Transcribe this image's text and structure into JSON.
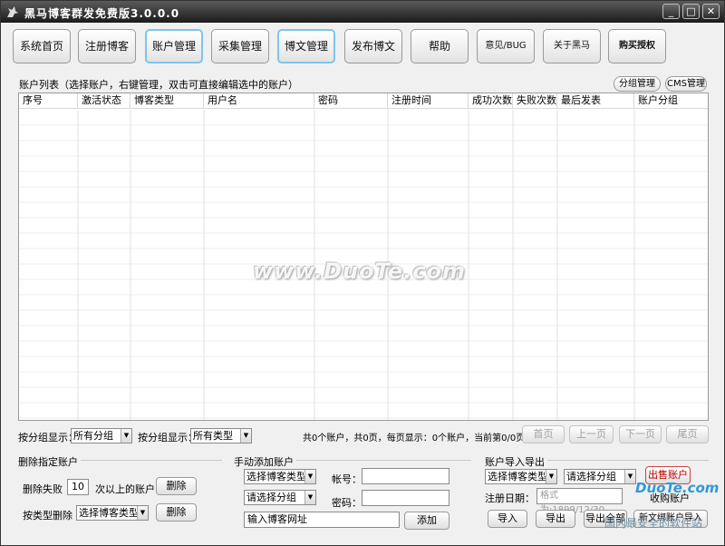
{
  "window": {
    "title": "黑马博客群发免费版3.0.0.0",
    "min": "_",
    "max": "□",
    "close": "✕"
  },
  "nav": [
    {
      "label": "系统首页",
      "highlight": false
    },
    {
      "label": "注册博客",
      "highlight": false
    },
    {
      "label": "账户管理",
      "highlight": true
    },
    {
      "label": "采集管理",
      "highlight": false
    },
    {
      "label": "博文管理",
      "highlight": true
    },
    {
      "label": "发布博文",
      "highlight": false
    },
    {
      "label": "帮助",
      "highlight": false
    },
    {
      "label": "意见/BUG",
      "highlight": false
    },
    {
      "label": "关于黑马",
      "highlight": false
    },
    {
      "label": "购买授权",
      "highlight": false
    }
  ],
  "list": {
    "caption": "账户列表（选择账户，右键管理，双击可直接编辑选中的账户）",
    "group_manage": "分组管理",
    "cms_manage": "CMS管理",
    "columns": [
      "序号",
      "激活状态",
      "博客类型",
      "用户名",
      "密码",
      "注册时间",
      "成功次数",
      "失败次数",
      "最后发表",
      "账户分组"
    ]
  },
  "filter": {
    "group_label": "按分组显示：",
    "group_value": "所有分组",
    "type_label": "按分组显示：",
    "type_value": "所有类型",
    "status": "共0个账户，共0页，每页显示：0个账户，当前第0/0页",
    "first": "首页",
    "prev": "上一页",
    "next": "下一页",
    "last": "尾页"
  },
  "delete_group": {
    "title": "删除指定账户",
    "fail_label": "删除失败",
    "fail_count": "10",
    "fail_suffix": "次以上的账户",
    "delete1": "删除",
    "type_label": "按类型删除",
    "type_value": "选择博客类型",
    "delete2": "删除"
  },
  "manual_add": {
    "title": "手动添加账户",
    "type_value": "选择博客类型",
    "group_value": "请选择分组",
    "account_label": "帐号：",
    "password_label": "密码：",
    "url_value": "输入博客网址",
    "add": "添加"
  },
  "import_export": {
    "title": "账户导入导出",
    "type_value": "选择博客类型",
    "group_value": "请选择分组",
    "sell": "出售账户",
    "date_label": "注册日期：",
    "date_value": "格式为:1899/12/30",
    "acquire": "收购账户",
    "import": "导入",
    "export": "导出",
    "export_all": "导出全部",
    "import_new": "新文绑账户导入"
  },
  "watermarks": {
    "main": "www.DuoTe.com",
    "corner": "DuoTe.com",
    "corner2": "国内最安全的软件站"
  }
}
